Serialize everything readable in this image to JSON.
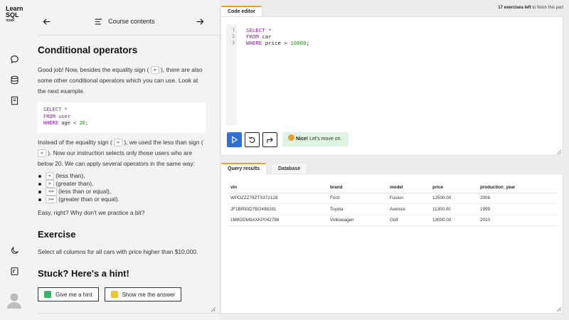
{
  "logo": {
    "line1": "Learn",
    "line2": "SQL",
    "line3": "•com"
  },
  "rail": {
    "chat_icon": "chat-icon",
    "database_icon": "database-icon",
    "cheatsheet_icon": "book-icon",
    "darkmode_icon": "moon-icon",
    "notes_icon": "notes-icon"
  },
  "nav": {
    "title": "Course contents"
  },
  "lesson": {
    "title": "Conditional operators",
    "intro_1": "Good job! Now, besides the equality sign (",
    "intro_eq": "=",
    "intro_2": "), there are also some other conditional operators which you can use. Look at the next example.",
    "code": [
      "SELECT *",
      "FROM user",
      "WHERE age < 20;"
    ],
    "p2_1": "Instead of the equality sign (",
    "p2_eq": "=",
    "p2_2": "), we used the less than sign (",
    "p2_lt": "<",
    "p2_3": "). Now our instruction selects only those users who are below 20. We can apply several operators in the same way:",
    "operators": [
      {
        "op": "<",
        "text": "(less than),"
      },
      {
        "op": ">",
        "text": "(greater than),"
      },
      {
        "op": "<=",
        "text": "(less than or equal),"
      },
      {
        "op": ">=",
        "text": "(greater than or equal)."
      }
    ],
    "closing": "Easy, right? Why don't we practice a bit?"
  },
  "exercise": {
    "heading": "Exercise",
    "text": "Select all columns for all cars with price higher than $10,000."
  },
  "hint": {
    "heading": "Stuck? Here's a hint!",
    "give_hint": "Give me a hint",
    "show_answer": "Show me the answer"
  },
  "editor": {
    "tab": "Code editor",
    "exercises_count": "17 exercises left",
    "exercises_suffix": "to finish this part",
    "gutter": [
      "1",
      "2",
      "3"
    ],
    "code": {
      "l1": "SELECT *",
      "l2_kw": "FROM",
      "l2_rest": "car",
      "l3_kw": "WHERE",
      "l3_rest": "price >",
      "l3_num": "10000",
      "l3_end": ";"
    },
    "feedback_bold": "Nice!",
    "feedback_text": "Let's move on."
  },
  "results": {
    "tab_results": "Query results",
    "tab_database": "Database",
    "columns": [
      "vin",
      "brand",
      "model",
      "price",
      "production_year"
    ],
    "rows": [
      [
        "WPOZZZ79ZTS372128",
        "Ford",
        "Fusion",
        "12500.00",
        "2008"
      ],
      [
        "JF1BR93D7BG498281",
        "Toyota",
        "Avensis",
        "11300.00",
        "1999"
      ],
      [
        "1M8GDM9AXKP042788",
        "Volkswagen",
        "Golf",
        "13000.00",
        "2010"
      ]
    ]
  },
  "colors": {
    "accent": "#2f6fd8",
    "tab_highlight": "#e8a12b",
    "feedback_bg": "#dff3e3",
    "sql_keyword": "#8a2a9b",
    "sql_number": "#2b8a2b"
  }
}
